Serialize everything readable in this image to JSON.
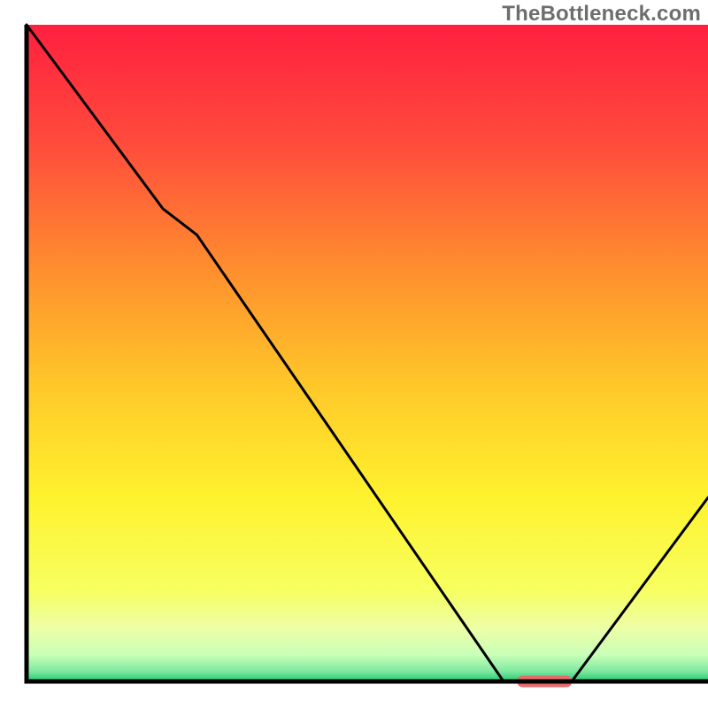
{
  "watermark": "TheBottleneck.com",
  "chart_data": {
    "type": "line",
    "title": "",
    "xlabel": "",
    "ylabel": "",
    "xlim": [
      0,
      100
    ],
    "ylim": [
      0,
      100
    ],
    "grid": false,
    "legend": false,
    "x": [
      0,
      20,
      25,
      70,
      80,
      100
    ],
    "values": [
      100,
      72,
      68,
      0,
      0,
      28
    ],
    "marker": {
      "x_start": 72,
      "x_end": 80,
      "y": 0,
      "color": "#e96a6d"
    },
    "background_gradient": {
      "type": "vertical",
      "stops": [
        {
          "pos": 0.0,
          "color": "#ff203f"
        },
        {
          "pos": 0.18,
          "color": "#ff4b3c"
        },
        {
          "pos": 0.36,
          "color": "#ff8a2f"
        },
        {
          "pos": 0.55,
          "color": "#ffc829"
        },
        {
          "pos": 0.72,
          "color": "#fff22e"
        },
        {
          "pos": 0.86,
          "color": "#f7ff5f"
        },
        {
          "pos": 0.92,
          "color": "#ecffa8"
        },
        {
          "pos": 0.96,
          "color": "#c8ffb8"
        },
        {
          "pos": 0.985,
          "color": "#7de8a0"
        },
        {
          "pos": 1.0,
          "color": "#1dc86a"
        }
      ]
    },
    "axes_color": "#000000",
    "line_color": "#000000"
  }
}
